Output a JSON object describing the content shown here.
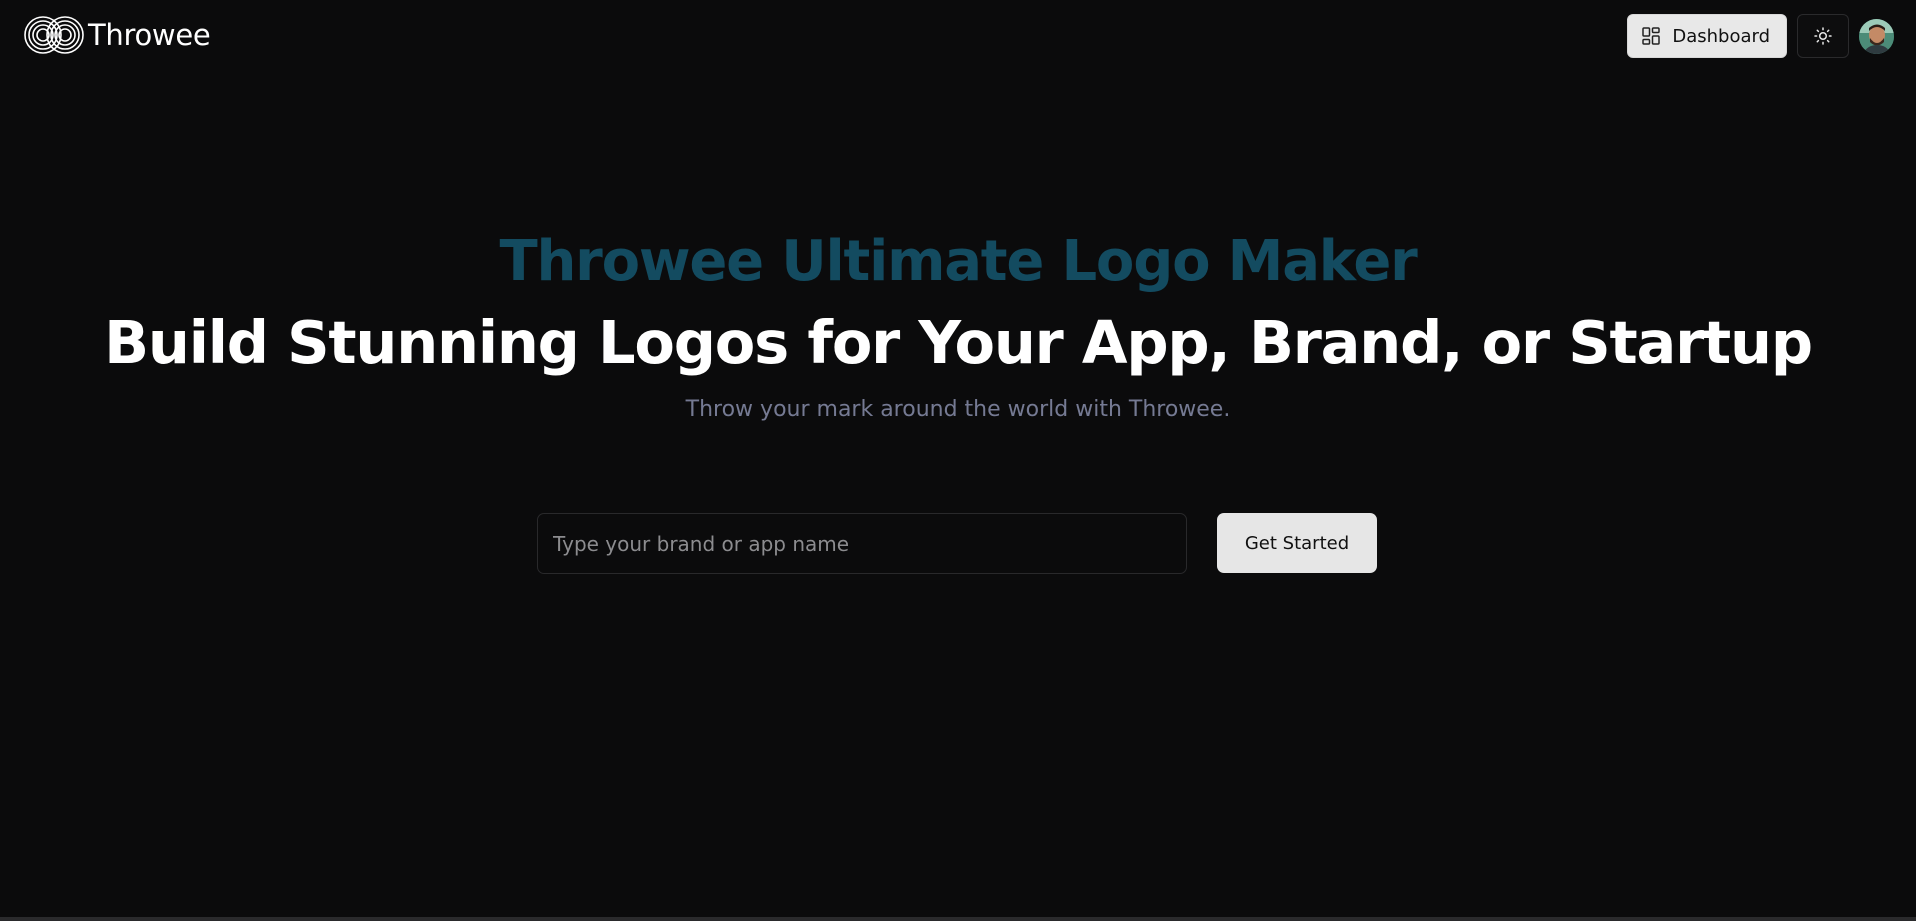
{
  "header": {
    "brand_name": "Throwee",
    "logo_icon": "interlocking-rings-logo",
    "dashboard_label": "Dashboard",
    "dashboard_icon": "dashboard-grid-icon",
    "theme_icon": "sun-icon",
    "avatar_icon": "user-avatar"
  },
  "hero": {
    "kicker": "Throwee Ultimate Logo Maker",
    "title": "Build Stunning Logos for Your App, Brand, or Startup",
    "subtitle": "Throw your mark around the world with Throwee.",
    "colors": {
      "kicker": "#134b60",
      "title": "#ffffff",
      "subtitle": "#757a93"
    }
  },
  "form": {
    "input_placeholder": "Type your brand or app name",
    "input_value": "",
    "submit_label": "Get Started"
  },
  "theme": {
    "background": "#0b0b0c",
    "button_light": "#e6e6e6"
  }
}
